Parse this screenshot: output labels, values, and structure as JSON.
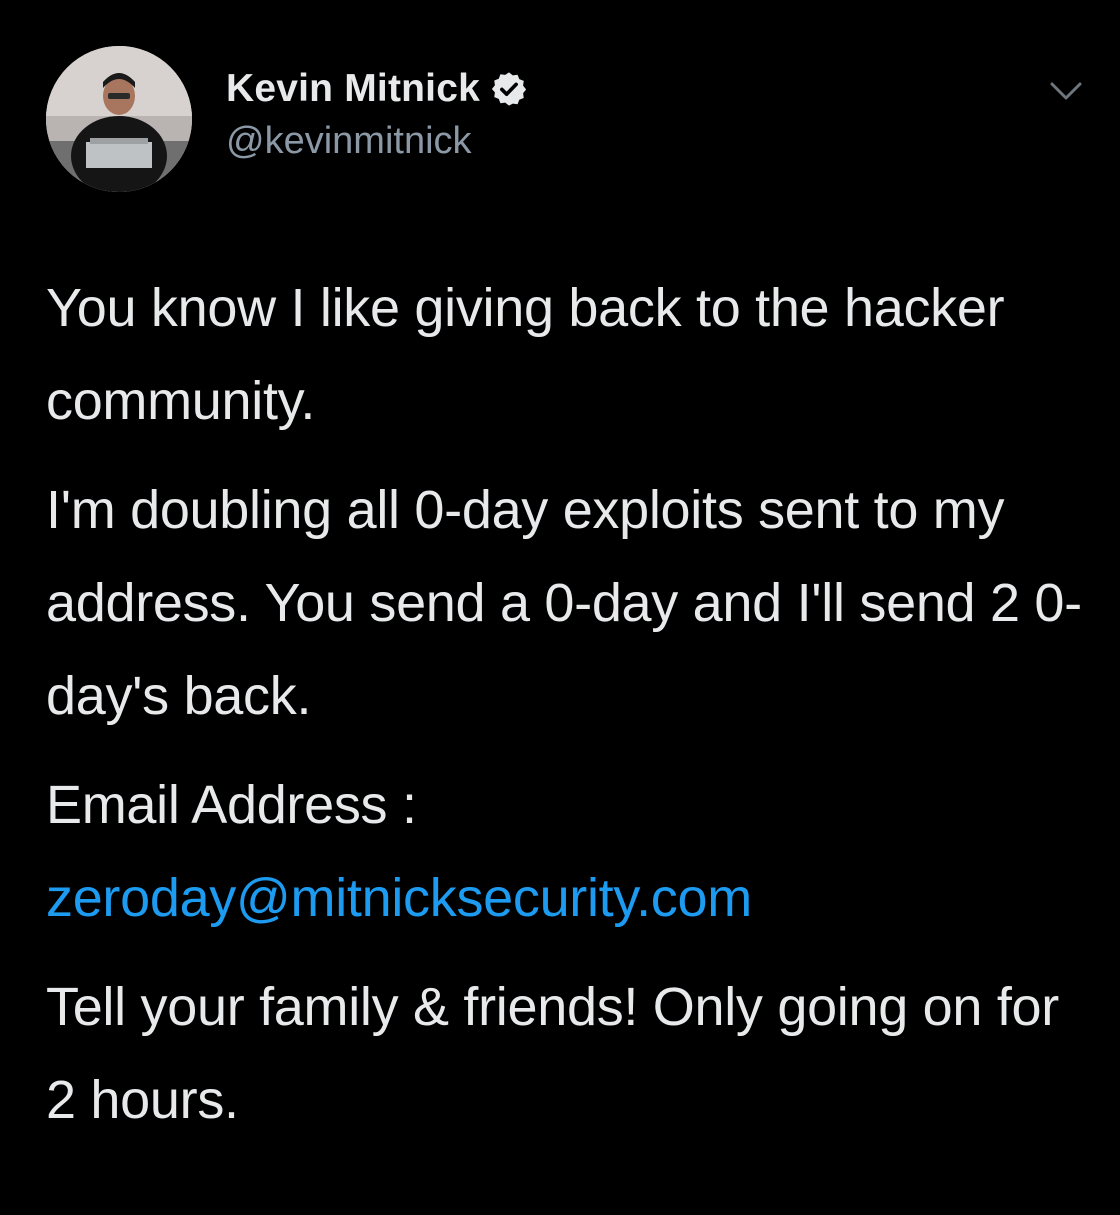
{
  "author": {
    "display_name": "Kevin Mitnick",
    "handle": "@kevinmitnick",
    "verified_icon": "verified-badge-icon",
    "avatar": "profile-photo"
  },
  "menu_icon": "chevron-down-icon",
  "tweet": {
    "paragraphs": [
      "You know I like giving back to the hacker community.",
      "I'm doubling all 0-day exploits sent to my address. You send a 0-day and I'll send 2 0-day's back."
    ],
    "email_label": "Email Address :",
    "email_link": "zeroday@mitnicksecurity.com",
    "closing": "Tell your family & friends! Only going on for 2 hours."
  },
  "colors": {
    "background": "#000000",
    "text": "#e7e9ea",
    "secondary_text": "#8b98a5",
    "link": "#1d9bf0"
  }
}
